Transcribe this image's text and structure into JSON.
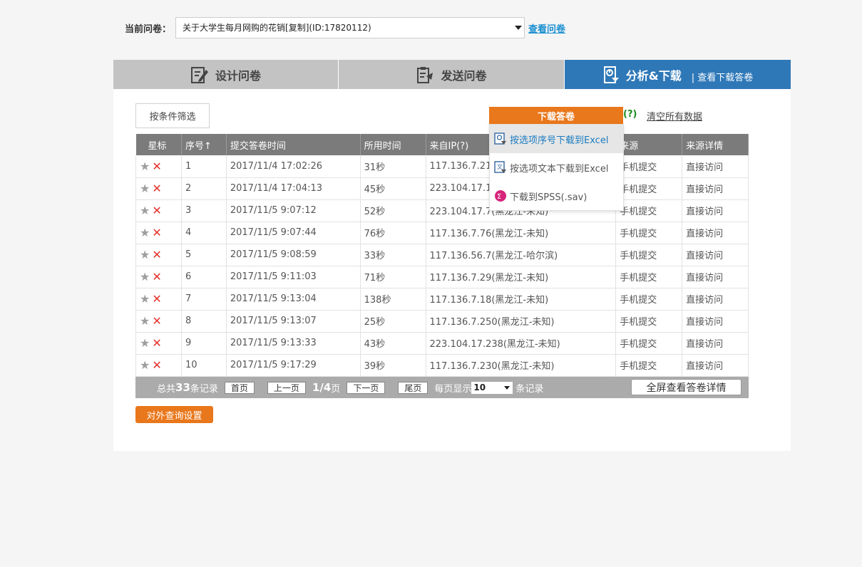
{
  "header": {
    "label": "当前问卷：",
    "survey_selected": "关于大学生每月网购的花销[复制](ID:17820112)",
    "view_link": "查看问卷"
  },
  "tabs": [
    {
      "label": "设计问卷",
      "icon": "edit-doc-icon"
    },
    {
      "label": "发送问卷",
      "icon": "send-doc-icon"
    },
    {
      "label": "分析&下载",
      "icon": "download-report-icon",
      "sub": "| 查看下载答卷",
      "active": true
    }
  ],
  "toolbar": {
    "filter_button": "按条件筛选",
    "download_header": "下载答卷",
    "help": "(?)",
    "clear_link": "清空所有数据"
  },
  "download_menu": [
    {
      "label": "按选项序号下载到Excel",
      "icon": "excel-index-icon"
    },
    {
      "label": "按选项文本下载到Excel",
      "icon": "excel-text-icon"
    },
    {
      "label": "下载到SPSS(.sav)",
      "icon": "spss-icon"
    }
  ],
  "table": {
    "columns": [
      "星标",
      "序号↑",
      "提交答卷时间",
      "所用时间",
      "来自IP(?)",
      "来源",
      "来源详情"
    ],
    "rows": [
      {
        "no": "1",
        "time": "2017/11/4 17:02:26",
        "duration": "31秒",
        "ip": "117.136.7.21",
        "source": "手机提交",
        "detail": "直接访问"
      },
      {
        "no": "2",
        "time": "2017/11/4 17:04:13",
        "duration": "45秒",
        "ip": "223.104.17.1",
        "source": "手机提交",
        "detail": "直接访问"
      },
      {
        "no": "3",
        "time": "2017/11/5 9:07:12",
        "duration": "52秒",
        "ip": "223.104.17.7(黑龙江-未知)",
        "source": "手机提交",
        "detail": "直接访问"
      },
      {
        "no": "4",
        "time": "2017/11/5 9:07:44",
        "duration": "76秒",
        "ip": "117.136.7.76(黑龙江-未知)",
        "source": "手机提交",
        "detail": "直接访问"
      },
      {
        "no": "5",
        "time": "2017/11/5 9:08:59",
        "duration": "33秒",
        "ip": "117.136.56.7(黑龙江-哈尔滨)",
        "source": "手机提交",
        "detail": "直接访问"
      },
      {
        "no": "6",
        "time": "2017/11/5 9:11:03",
        "duration": "71秒",
        "ip": "117.136.7.29(黑龙江-未知)",
        "source": "手机提交",
        "detail": "直接访问"
      },
      {
        "no": "7",
        "time": "2017/11/5 9:13:04",
        "duration": "138秒",
        "ip": "117.136.7.18(黑龙江-未知)",
        "source": "手机提交",
        "detail": "直接访问"
      },
      {
        "no": "8",
        "time": "2017/11/5 9:13:07",
        "duration": "25秒",
        "ip": "117.136.7.250(黑龙江-未知)",
        "source": "手机提交",
        "detail": "直接访问"
      },
      {
        "no": "9",
        "time": "2017/11/5 9:13:33",
        "duration": "43秒",
        "ip": "223.104.17.238(黑龙江-未知)",
        "source": "手机提交",
        "detail": "直接访问"
      },
      {
        "no": "10",
        "time": "2017/11/5 9:17:29",
        "duration": "39秒",
        "ip": "117.136.7.230(黑龙江-未知)",
        "source": "手机提交",
        "detail": "直接访问"
      }
    ]
  },
  "pager": {
    "total_prefix": "总共",
    "total": "33",
    "total_suffix": "条记录",
    "first": "首页",
    "prev": "上一页",
    "page_info": "1/4",
    "page_suffix": "页",
    "next": "下一页",
    "last": "尾页",
    "per_page_label": "每页显示",
    "per_page": "10",
    "per_page_suffix": "条记录",
    "fullscreen": "全屏查看答卷详情"
  },
  "footer": {
    "external_query": "对外查询设置"
  },
  "colors": {
    "accent_orange": "#e9771b",
    "active_tab_blue": "#2e78b8",
    "link_blue": "#1a8fd0"
  }
}
